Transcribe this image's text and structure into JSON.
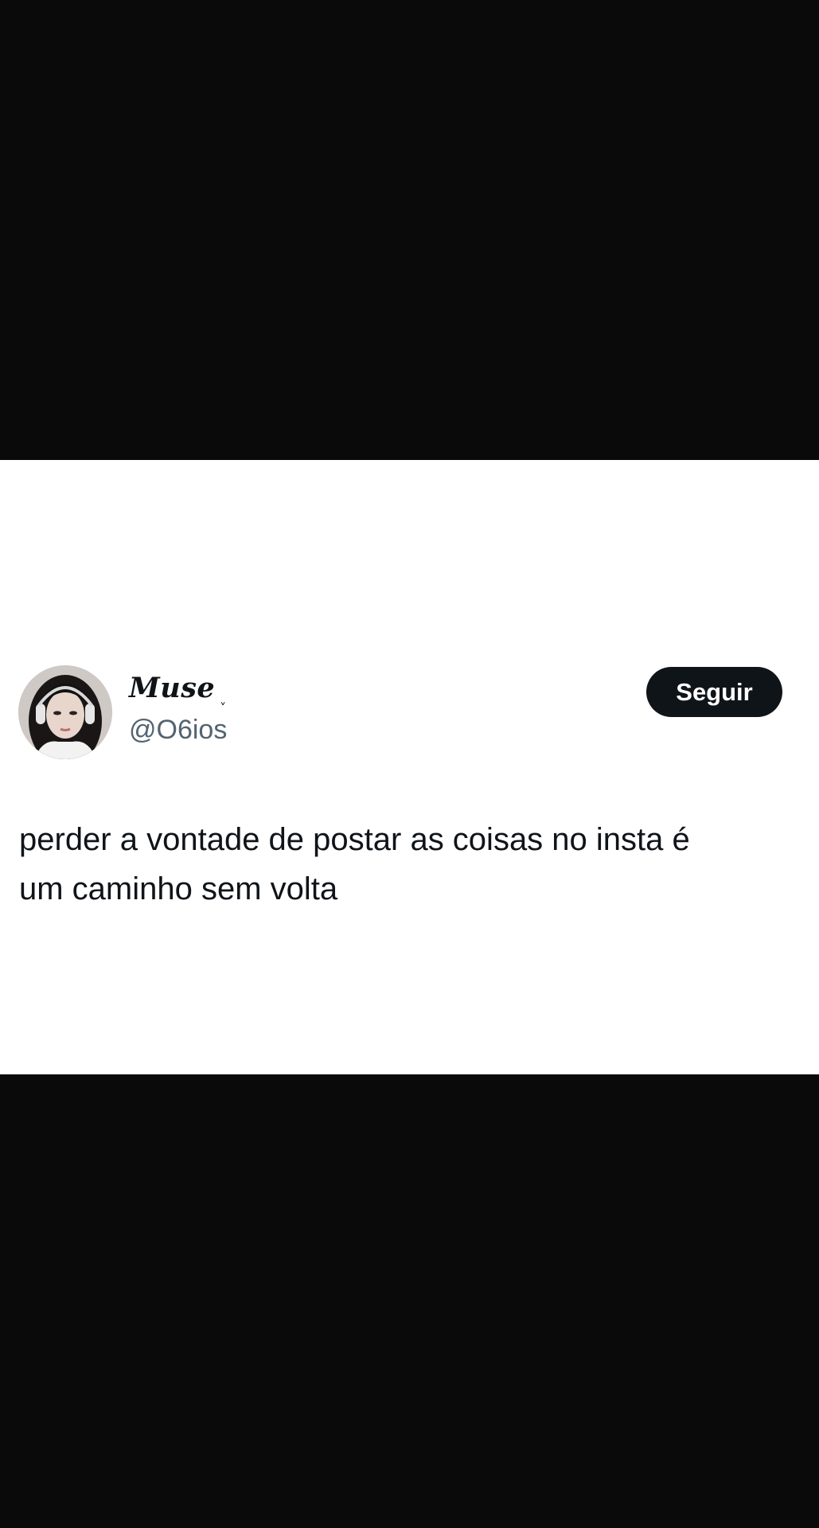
{
  "tweet": {
    "author": {
      "display_name": "Muse",
      "name_mark": "ˬ",
      "handle": "@O6ios",
      "avatar_icon": "profile-photo"
    },
    "follow_label": "Seguir",
    "text": "perder a vontade de postar as coisas no insta é\num caminho sem volta"
  },
  "colors": {
    "background": "#0a0a0b",
    "card": "#ffffff",
    "text_primary": "#0f1419",
    "text_secondary": "#536471",
    "button_bg": "#0f1419",
    "button_text": "#ffffff"
  }
}
